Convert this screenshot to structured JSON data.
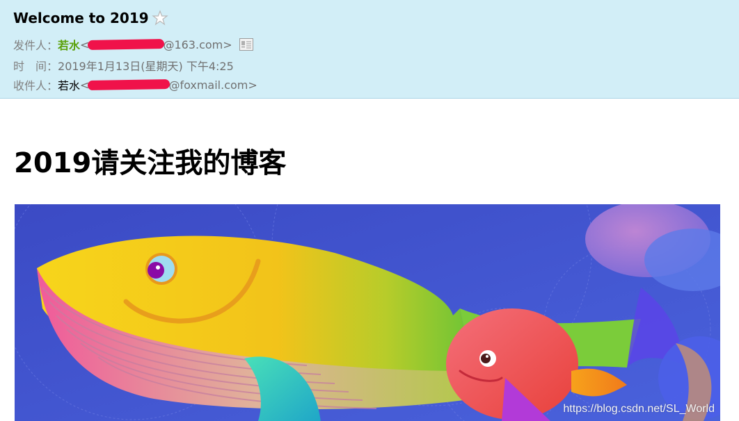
{
  "email": {
    "subject": "Welcome to 2019",
    "sender_label": "发件人：",
    "sender_name": "若水",
    "sender_open": " <",
    "sender_address_tail": "@163.com>",
    "time_label": "时　间：",
    "time_value": "2019年1月13日(星期天) 下午4:25",
    "recipient_label": "收件人：",
    "recipient_name": "若水",
    "recipient_open": " <",
    "recipient_address_tail": "@foxmail.com>"
  },
  "body": {
    "title": "2019请关注我的博客",
    "banner_watermark": "https://blog.csdn.net/SL_World"
  },
  "colors": {
    "header_bg": "#d2eef7",
    "sender_name": "#5aa10a",
    "redaction": "#f0124a",
    "banner_bg": "#3f4fc8"
  },
  "icons": {
    "star": "star-outline-icon",
    "contact_card": "contact-card-icon"
  }
}
